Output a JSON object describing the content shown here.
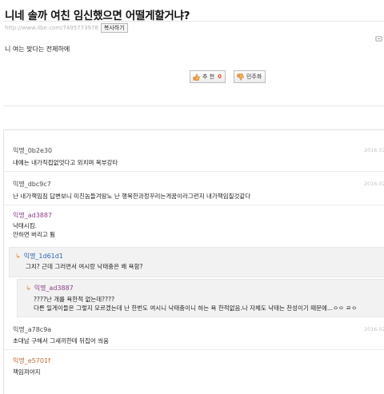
{
  "post": {
    "title": "니네 솔까 여친 임신했으면 어떨게할거냐?",
    "url": "http://www.ilbe.com/7495773978",
    "copy_label": "복사하기",
    "body": "니 여는 맞다는 전제하에",
    "upvote_label": "추 천",
    "upvote_count": "0",
    "report_label": "민주화"
  },
  "colors": {
    "author_default": "#4a4a4a",
    "author_purple": "#8a3f88",
    "author_blue": "#2f62b5",
    "author_orange": "#c36a3a",
    "accent": "#e0522b"
  },
  "icons": {
    "settings": "settings-icon",
    "upvote": "thumbs-up-icon",
    "report": "thumbs-down-icon",
    "reply": "reply-arrow-icon"
  },
  "comments": [
    {
      "author": "익명_0b2e30",
      "date": "2016.02",
      "text": [
        "내예는 내가직접없엇다고 외치며 복부강타"
      ]
    },
    {
      "author": "익명_dbc9c7",
      "date": "2016.02",
      "text": [
        "난 내가책임짐 답변보니 미친놈들겨땅노 난 행복한과정꾸리는게꿈이라그런지 내가책임질것같다"
      ]
    },
    {
      "author": "익명_ad3887",
      "date": "",
      "text": [
        "낙태시킴.",
        "안하면 버리고 튐"
      ]
    },
    {
      "author": "익명_1d61d1",
      "date": "",
      "text": [
        "그치? 근데 그러면서 여시랑 낙태충은 왜 욕함?"
      ]
    },
    {
      "author": "익명_ad3887",
      "date": "",
      "text": [
        "????난 개를 욕한적 없는데????",
        "다른 일게이들은 그렇지 모르겠는데 난 한번도 여시니 낙태충이니 하는 욕 한적없음.나 자체도 낙태는 찬성이기 때문에...ㅇㅇ ㄹㅇ"
      ]
    },
    {
      "author": "익명_a78c9a",
      "date": "2016.02",
      "text": [
        "초대남 구해서 그새끼한테 뒤집어 씌움"
      ]
    },
    {
      "author": "익명_e5701f",
      "date": "",
      "text": [
        "책임져야지"
      ]
    }
  ]
}
